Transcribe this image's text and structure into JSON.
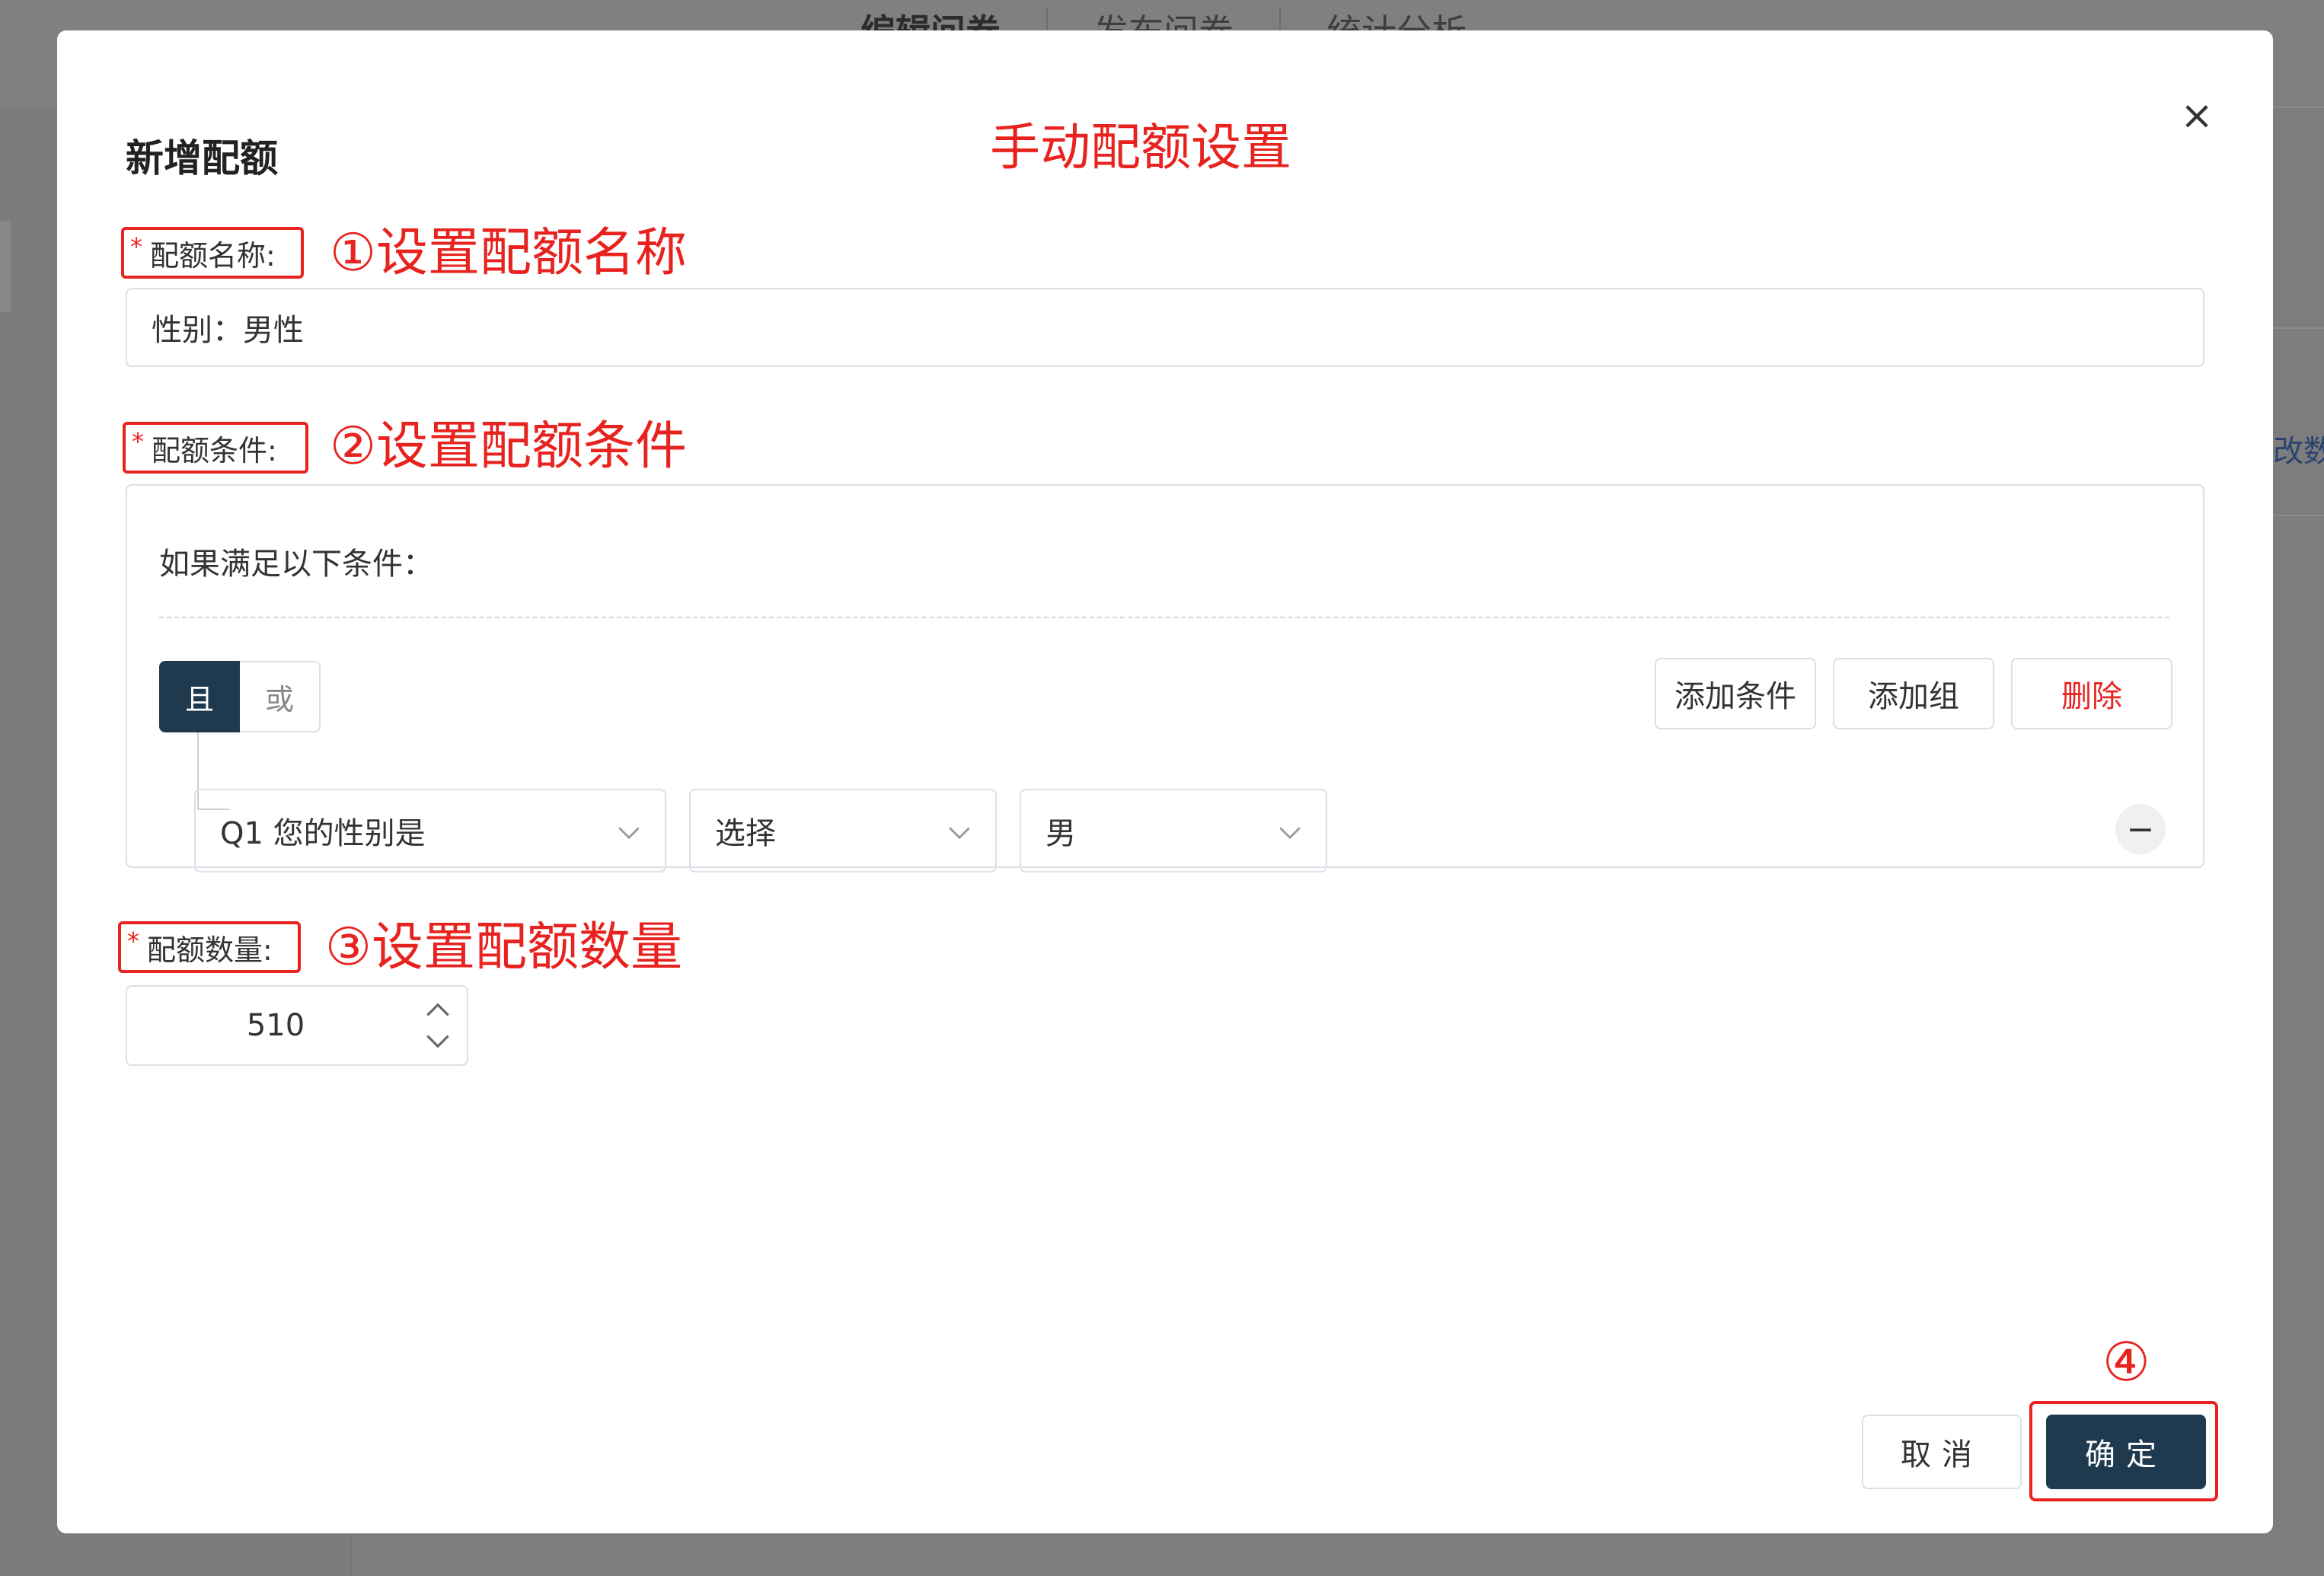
{
  "background": {
    "tabs": [
      "编辑问卷",
      "发布问卷",
      "统计分析"
    ],
    "right_text": "改数量"
  },
  "modal": {
    "title": "新增配额",
    "annotation_header": "手动配额设置",
    "close_glyph": "×",
    "quota_name": {
      "required_mark": "*",
      "label": "配额名称:",
      "annotation": "①设置配额名称",
      "value": "性别：男性"
    },
    "quota_condition": {
      "required_mark": "*",
      "label": "配额条件:",
      "annotation": "②设置配额条件",
      "heading": "如果满足以下条件：",
      "logic_and": "且",
      "logic_or": "或",
      "add_condition": "添加条件",
      "add_group": "添加组",
      "delete": "删除",
      "rule": {
        "question": "Q1 您的性别是",
        "operator": "选择",
        "value": "男"
      },
      "remove_glyph": "−"
    },
    "quota_count": {
      "required_mark": "*",
      "label": "配额数量:",
      "annotation": "③设置配额数量",
      "value": "510"
    },
    "footer": {
      "cancel": "取消",
      "confirm": "确定",
      "annotation": "④"
    }
  },
  "colors": {
    "annotation_red": "#e8231f",
    "primary_dark": "#1f3a4f",
    "border": "#dcdfe6"
  }
}
